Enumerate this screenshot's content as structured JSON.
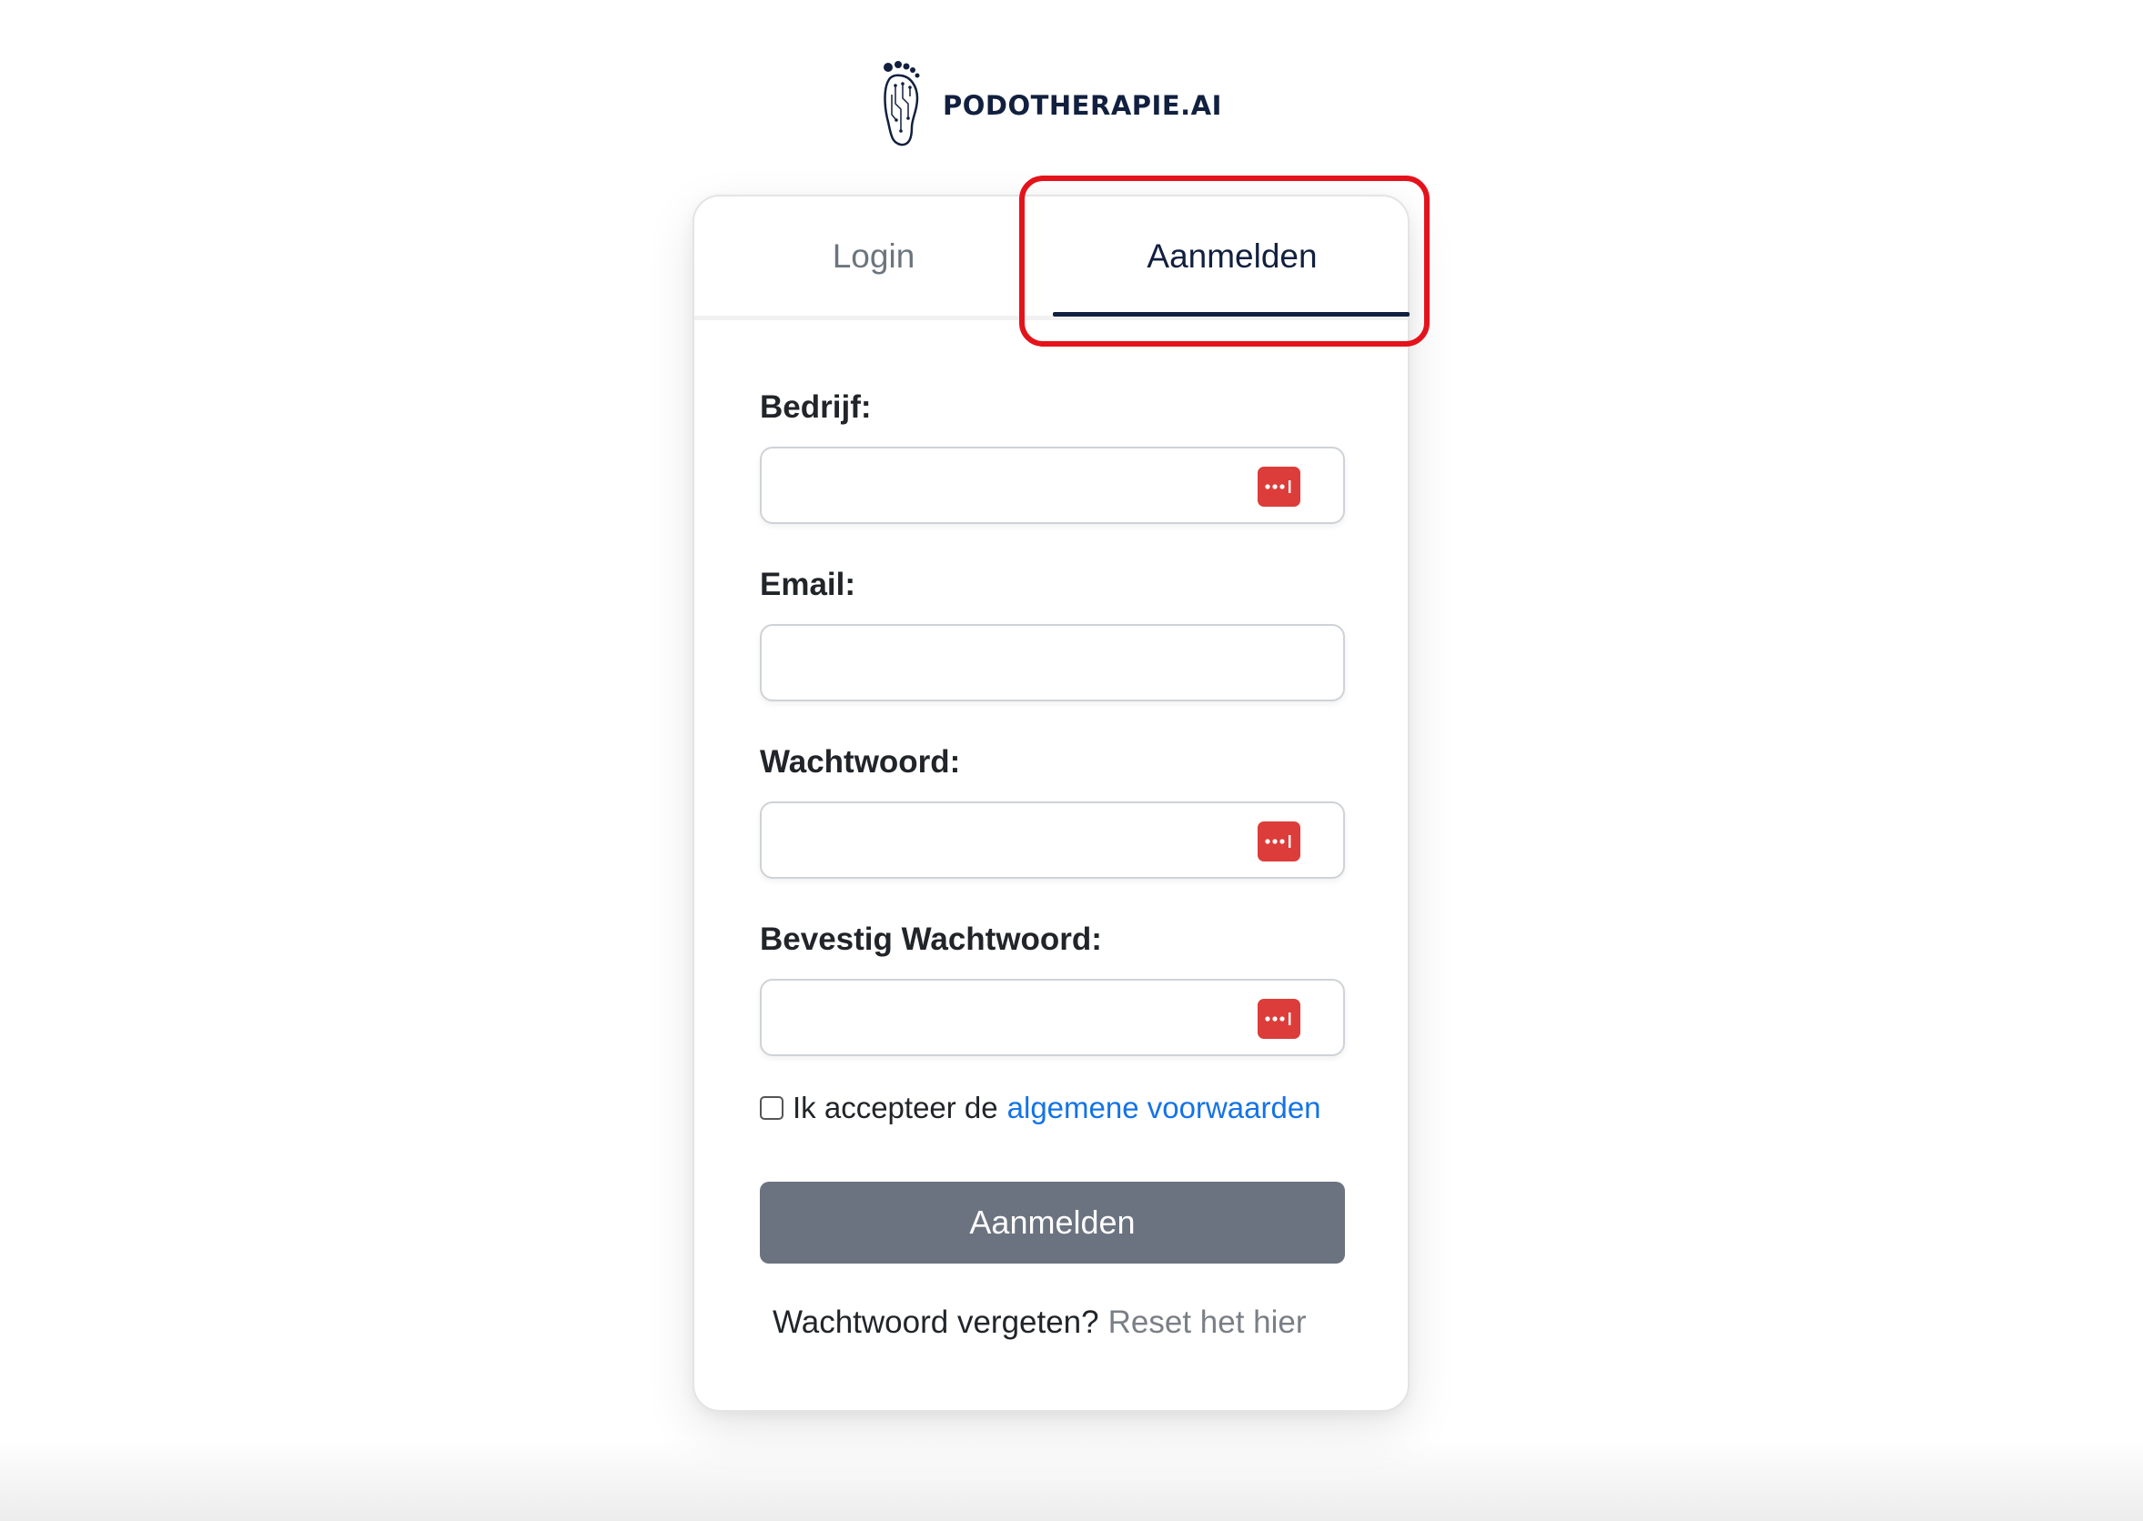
{
  "logo": {
    "text": "PODOTHERAPIE.AI",
    "icon": "foot-circuit-logo-icon"
  },
  "tabs": [
    {
      "label": "Login",
      "active": false
    },
    {
      "label": "Aanmelden",
      "active": true
    }
  ],
  "form": {
    "fields": [
      {
        "label": "Bedrijf:",
        "value": "",
        "has_password_manager_icon": true
      },
      {
        "label": "Email:",
        "value": "",
        "has_password_manager_icon": false
      },
      {
        "label": "Wachtwoord:",
        "value": "",
        "has_password_manager_icon": true
      },
      {
        "label": "Bevestig Wachtwoord:",
        "value": "",
        "has_password_manager_icon": true
      }
    ],
    "terms_text": "Ik accepteer de",
    "terms_link": "algemene voorwaarden",
    "terms_checked": false,
    "submit_label": "Aanmelden",
    "forgot_text": "Wachtwoord vergeten?",
    "reset_link": "Reset het hier"
  },
  "colors": {
    "brand_navy": "#12203f",
    "link_blue": "#1473e6",
    "button_gray": "#6c7380",
    "password_icon_red": "#dc3d3a",
    "highlight_red": "#e4131b"
  },
  "annotation": {
    "highlight_target": "tab-aanmelden"
  }
}
